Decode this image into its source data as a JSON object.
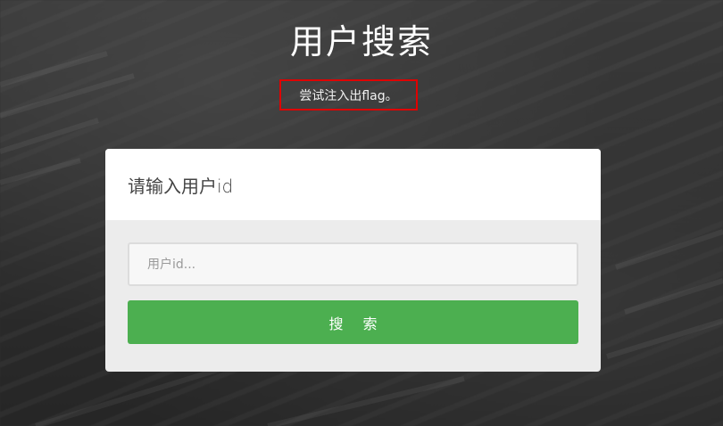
{
  "page": {
    "title": "用户搜索",
    "hint": "尝试注入出flag。"
  },
  "panel": {
    "heading": "请输入用户id",
    "input": {
      "placeholder": "用户id...",
      "value": ""
    },
    "search_button_label": "搜索"
  },
  "colors": {
    "button": "#4caf50",
    "hint_border": "#e00000",
    "background": "#2f2f2f"
  }
}
